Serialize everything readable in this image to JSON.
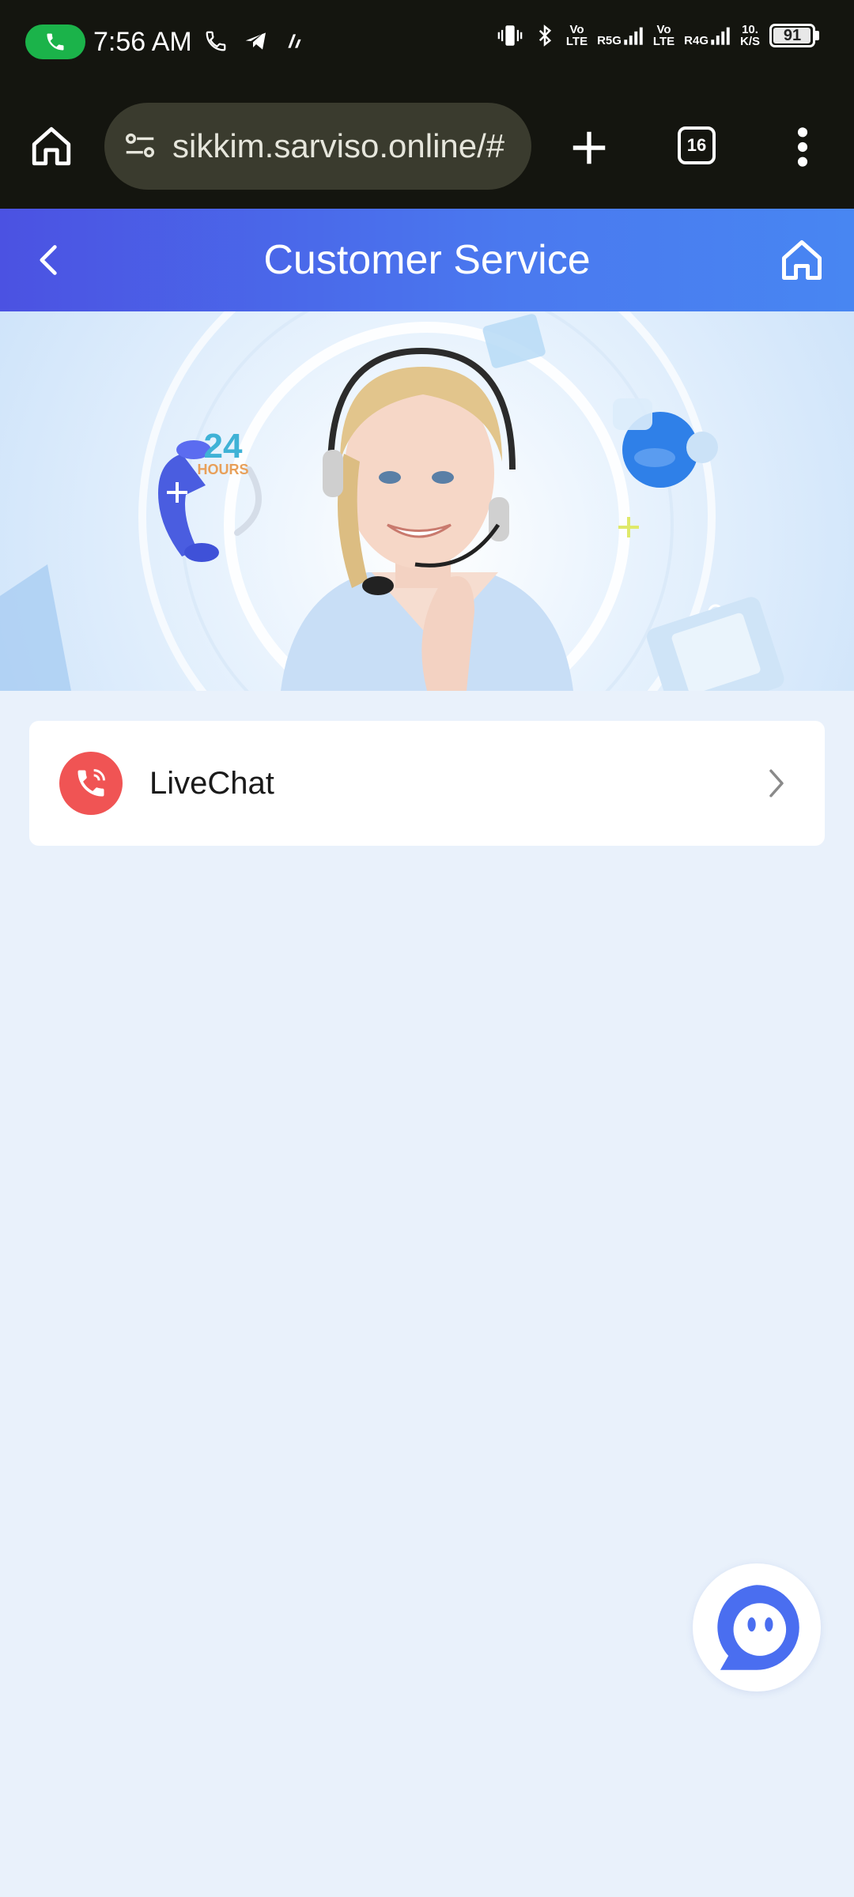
{
  "status_bar": {
    "time": "7:56 AM",
    "network_1": "Vo\nLTE",
    "network_2": "R5G",
    "network_3": "Vo\nLTE",
    "network_4": "R4G",
    "speed": "10.\nK/S",
    "battery": "91",
    "call_color": "#1bb34a"
  },
  "browser": {
    "url": "sikkim.sarviso.online/#",
    "tab_count": "16"
  },
  "header": {
    "title": "Customer Service",
    "gradient_start": "#4b52e2",
    "gradient_end": "#4886f2"
  },
  "banner": {
    "badge_number": "24",
    "badge_unit": "HOURS"
  },
  "services": [
    {
      "label": "LiveChat",
      "icon": "phone-icon",
      "icon_color": "#f05454"
    }
  ],
  "floating_button": {
    "icon": "chat-bot-icon",
    "color": "#4a6ef0"
  }
}
